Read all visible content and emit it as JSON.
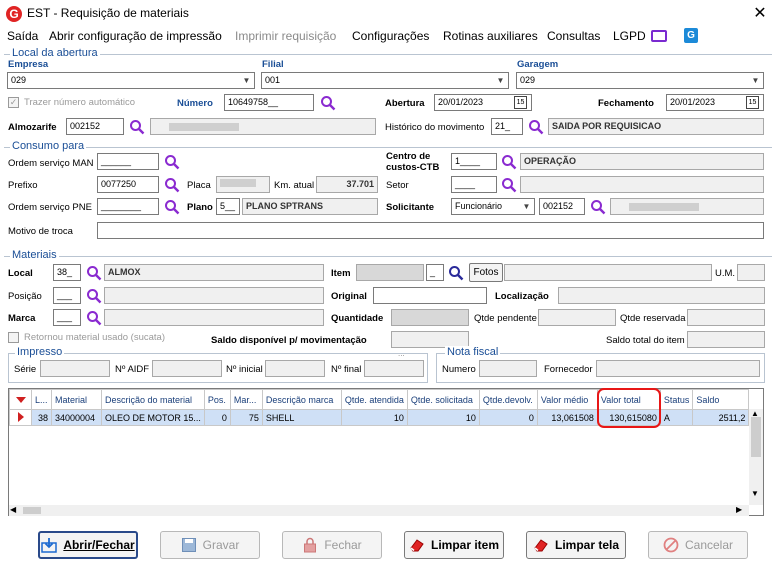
{
  "window": {
    "title": "EST - Requisição de materiais"
  },
  "menu": [
    "Saída",
    "Abrir configuração de impressão",
    "Imprimir requisição",
    "Configurações",
    "Rotinas auxiliares",
    "Consultas",
    "LGPD"
  ],
  "local_abertura": {
    "section": "Local da abertura",
    "empresa_label": "Empresa",
    "empresa_value": "029",
    "filial_label": "Filial",
    "filial_value": "001",
    "garagem_label": "Garagem",
    "garagem_value": "029",
    "trazer_label": "Trazer número automático",
    "numero_label": "Número",
    "numero_value": "10649758__",
    "abertura_label": "Abertura",
    "abertura_value": "20/01/2023",
    "fechamento_label": "Fechamento",
    "fechamento_value": "20/01/2023",
    "almox_label": "Almozarife",
    "almox_value": "002152",
    "historico_label": "Histórico do movimento",
    "historico_code": "21_",
    "historico_value": "SAIDA POR REQUISICAO"
  },
  "consumo": {
    "section": "Consumo para",
    "os_man_label": "Ordem serviço MAN",
    "os_man_value": "______",
    "centro_label": "Centro de custos-CTB",
    "centro_code": "1____",
    "centro_value": "OPERAÇÃO",
    "prefixo_label": "Prefixo",
    "prefixo_value": "0077250",
    "placa_label": "Placa",
    "km_label": "Km. atual",
    "km_value": "37.701",
    "setor_label": "Setor",
    "setor_value": "____",
    "os_pne_label": "Ordem serviço PNE",
    "os_pne_value": "________",
    "plano_label": "Plano",
    "plano_code": "5__",
    "plano_value": "PLANO SPTRANS",
    "solicitante_label": "Solicitante",
    "solicitante_type": "Funcionário",
    "solicitante_code": "002152",
    "motivo_label": "Motivo de troca"
  },
  "materiais": {
    "section": "Materiais",
    "local_label": "Local",
    "local_code": "38_",
    "local_value": "ALMOX",
    "item_label": "Item",
    "fotos_label": "Fotos",
    "um_label": "U.M.",
    "posicao_label": "Posição",
    "posicao_value": "___",
    "original_label": "Original",
    "localizacao_label": "Localização",
    "marca_label": "Marca",
    "marca_value": "___",
    "quantidade_label": "Quantidade",
    "qtde_pendente_label": "Qtde pendente",
    "qtde_reservada_label": "Qtde reservada",
    "retornou_label": "Retornou material usado (sucata)",
    "saldo_disp_label": "Saldo disponível p/ movimentação",
    "saldo_total_label": "Saldo total do item"
  },
  "impresso": {
    "section": "Impresso",
    "serie_label": "Série",
    "aidf_label": "Nº AIDF",
    "inicial_label": "Nº inicial",
    "final_label": "Nº final",
    "final_value": "..."
  },
  "nota_fiscal": {
    "section": "Nota fiscal",
    "numero_label": "Numero",
    "fornecedor_label": "Fornecedor"
  },
  "grid": {
    "columns": [
      "L...",
      "Material",
      "Descrição do material",
      "Pos.",
      "Mar...",
      "Descrição marca",
      "Qtde. atendida",
      "Qtde. solicitada",
      "Qtde.devolv.",
      "Valor médio",
      "Valor total",
      "Status",
      "Saldo"
    ],
    "rows": [
      [
        "38",
        "34000004",
        "OLEO DE MOTOR 15...",
        "0",
        "75",
        "SHELL",
        "10",
        "10",
        "0",
        "13,061508",
        "130,615080",
        "A",
        "2511,2"
      ]
    ]
  },
  "buttons": {
    "abrir": "Abrir/Fechar",
    "gravar": "Gravar",
    "fechar": "Fechar",
    "limpar_item": "Limpar item",
    "limpar_tela": "Limpar tela",
    "cancelar": "Cancelar"
  },
  "colors": {
    "accent": "#1a4e96",
    "highlight": "#e81717",
    "row_selected": "#cfe0f6"
  }
}
